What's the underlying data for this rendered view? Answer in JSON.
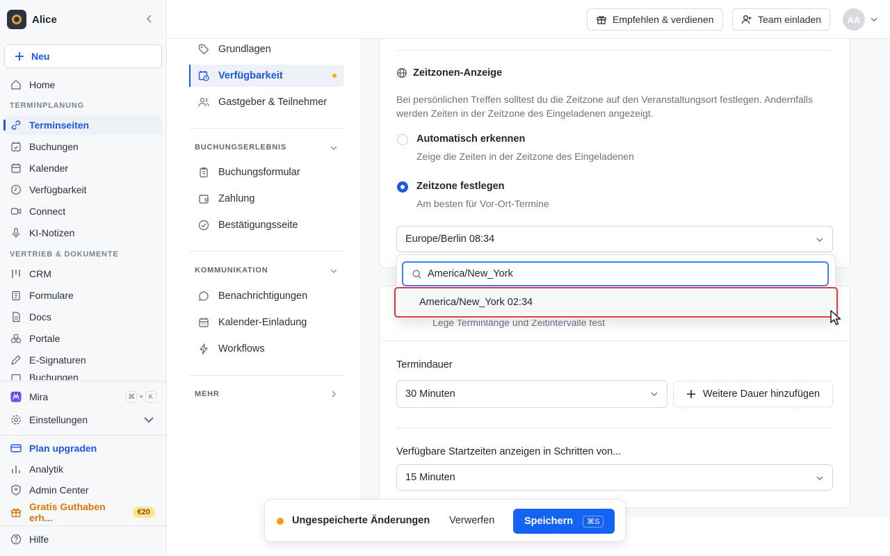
{
  "workspace": {
    "name": "Alice"
  },
  "sidebar": {
    "new_label": "Neu",
    "home": "Home",
    "section_scheduling": "TERMINPLANUNG",
    "scheduling_items": [
      "Terminseiten",
      "Buchungen",
      "Kalender",
      "Verfügbarkeit",
      "Connect",
      "KI-Notizen"
    ],
    "section_sales": "VERTRIEB & DOKUMENTE",
    "sales_items": [
      "CRM",
      "Formulare",
      "Docs",
      "Portale",
      "E-Signaturen",
      "Buchungen"
    ],
    "mira": "Mira",
    "mira_shortcut": [
      "⌘",
      "+",
      "K"
    ],
    "settings": "Einstellungen",
    "plan_upgrade": "Plan upgraden",
    "analytics": "Analytik",
    "admin_center": "Admin Center",
    "free_credit": "Gratis Guthaben erh...",
    "free_credit_badge": "€20",
    "help": "Hilfe"
  },
  "header": {
    "refer_label": "Empfehlen & verdienen",
    "invite_label": "Team einladen",
    "avatar_initials": "AA"
  },
  "event_nav": {
    "items": [
      "Grundlagen",
      "Verfügbarkeit",
      "Gastgeber & Teilnehmer"
    ],
    "section_booking": "BUCHUNGSERLEBNIS",
    "booking_items": [
      "Buchungsformular",
      "Zahlung",
      "Bestätigungsseite"
    ],
    "section_communication": "KOMMUNIKATION",
    "communication_items": [
      "Benachrichtigungen",
      "Kalender-Einladung",
      "Workflows"
    ],
    "section_more": "MEHR"
  },
  "timezone": {
    "title": "Zeitzonen-Anzeige",
    "description": "Bei persönlichen Treffen solltest du die Zeitzone auf den Veranstaltungsort festlegen. Andernfalls werden Zeiten in der Zeitzone des Eingeladenen angezeigt.",
    "option_auto_label": "Automatisch erkennen",
    "option_auto_sub": "Zeige die Zeiten in der Zeitzone des Eingeladenen",
    "option_fixed_label": "Zeitzone festlegen",
    "option_fixed_sub": "Am besten für Vor-Ort-Termine",
    "selected_value": "Europe/Berlin 08:34",
    "search_value": "America/New_York",
    "search_result": "America/New_York 02:34"
  },
  "duration": {
    "subtitle": "Lege Terminlänge und Zeitintervalle fest",
    "length_label": "Termindauer",
    "length_value": "30 Minuten",
    "add_duration": "Weitere Dauer hinzufügen",
    "interval_label": "Verfügbare Startzeiten anzeigen in Schritten von...",
    "interval_value": "15 Minuten"
  },
  "savebar": {
    "status": "Ungespeicherte Änderungen",
    "discard": "Verwerfen",
    "save": "Speichern",
    "save_shortcut": "⌘S"
  },
  "colors": {
    "accent": "#1a56e8",
    "warning": "#f59e0b",
    "highlight": "#e03a3a"
  }
}
